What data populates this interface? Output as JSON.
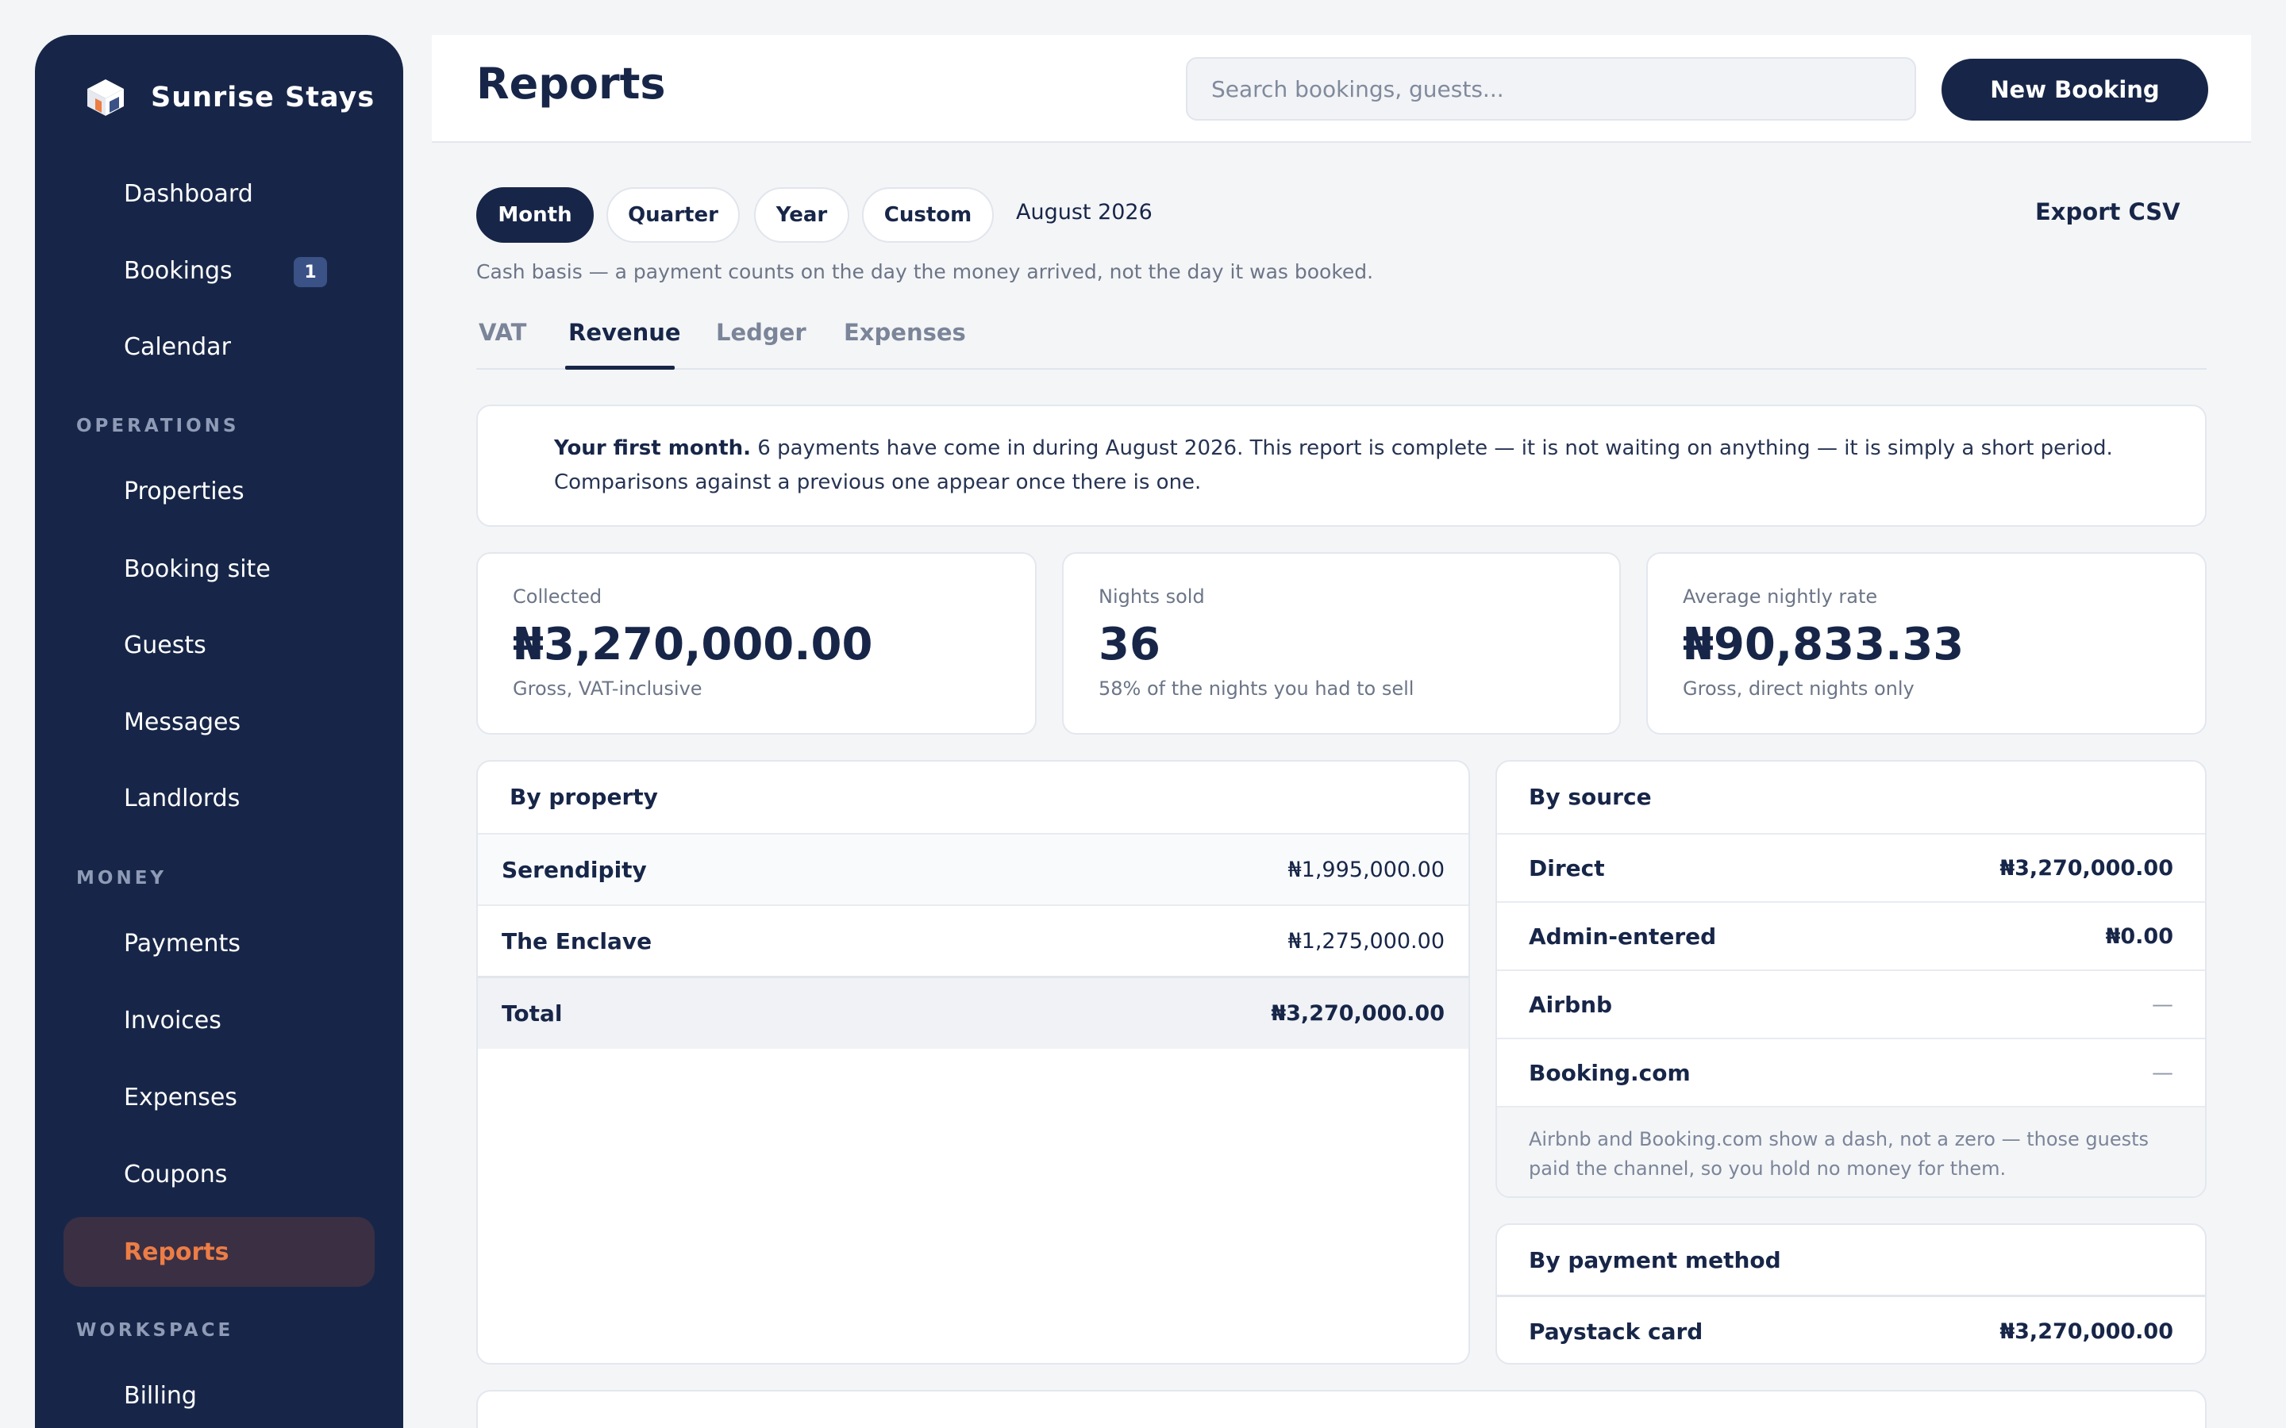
{
  "brand": {
    "name": "Sunrise Stays"
  },
  "sidebar": {
    "items": [
      {
        "label": "Dashboard"
      },
      {
        "label": "Bookings",
        "badge": "1"
      },
      {
        "label": "Calendar"
      },
      {
        "section": "OPERATIONS"
      },
      {
        "label": "Properties"
      },
      {
        "label": "Booking site"
      },
      {
        "label": "Guests"
      },
      {
        "label": "Messages"
      },
      {
        "label": "Landlords"
      },
      {
        "section": "MONEY"
      },
      {
        "label": "Payments"
      },
      {
        "label": "Invoices"
      },
      {
        "label": "Expenses"
      },
      {
        "label": "Coupons"
      },
      {
        "label": "Reports",
        "active": true
      },
      {
        "section": "WORKSPACE"
      },
      {
        "label": "Billing"
      }
    ]
  },
  "header": {
    "title": "Reports",
    "search_placeholder": "Search bookings, guests...",
    "new_booking_label": "New Booking"
  },
  "period": {
    "options": [
      "Month",
      "Quarter",
      "Year",
      "Custom"
    ],
    "selected": "Month",
    "label": "August 2026",
    "export_label": "Export CSV",
    "basis_note": "Cash basis — a payment counts on the day the money arrived, not the day it was booked."
  },
  "tabs": {
    "items": [
      "VAT",
      "Revenue",
      "Ledger",
      "Expenses"
    ],
    "active": "Revenue"
  },
  "notice": {
    "lead": "Your first month.",
    "body": " 6 payments have come in during August 2026. This report is complete — it is not waiting on anything — it is simply a short period. Comparisons against a previous one appear once there is one."
  },
  "kpis": {
    "collected": {
      "label": "Collected",
      "value": "₦3,270,000.00",
      "sub": "Gross, VAT-inclusive"
    },
    "nights": {
      "label": "Nights sold",
      "value": "36",
      "sub": "58% of the nights you had to sell"
    },
    "rate": {
      "label": "Average nightly rate",
      "value": "₦90,833.33",
      "sub": "Gross, direct nights only"
    }
  },
  "by_property": {
    "title": "By property",
    "rows": [
      {
        "name": "Serendipity",
        "value": "₦1,995,000.00"
      },
      {
        "name": "The Enclave",
        "value": "₦1,275,000.00"
      }
    ],
    "total": {
      "name": "Total",
      "value": "₦3,270,000.00"
    }
  },
  "by_source": {
    "title": "By source",
    "rows": [
      {
        "name": "Direct",
        "value": "₦3,270,000.00"
      },
      {
        "name": "Admin-entered",
        "value": "₦0.00"
      },
      {
        "name": "Airbnb",
        "value": "—"
      },
      {
        "name": "Booking.com",
        "value": "—"
      }
    ],
    "note": "Airbnb and Booking.com show a dash, not a zero — those guests paid the channel, so you hold no money for them."
  },
  "by_payment_method": {
    "title": "By payment method",
    "rows": [
      {
        "name": "Paystack card",
        "value": "₦3,270,000.00"
      }
    ]
  },
  "colors": {
    "navy": "#172648",
    "accent": "#ec7d45",
    "background": "#f4f5f7"
  }
}
